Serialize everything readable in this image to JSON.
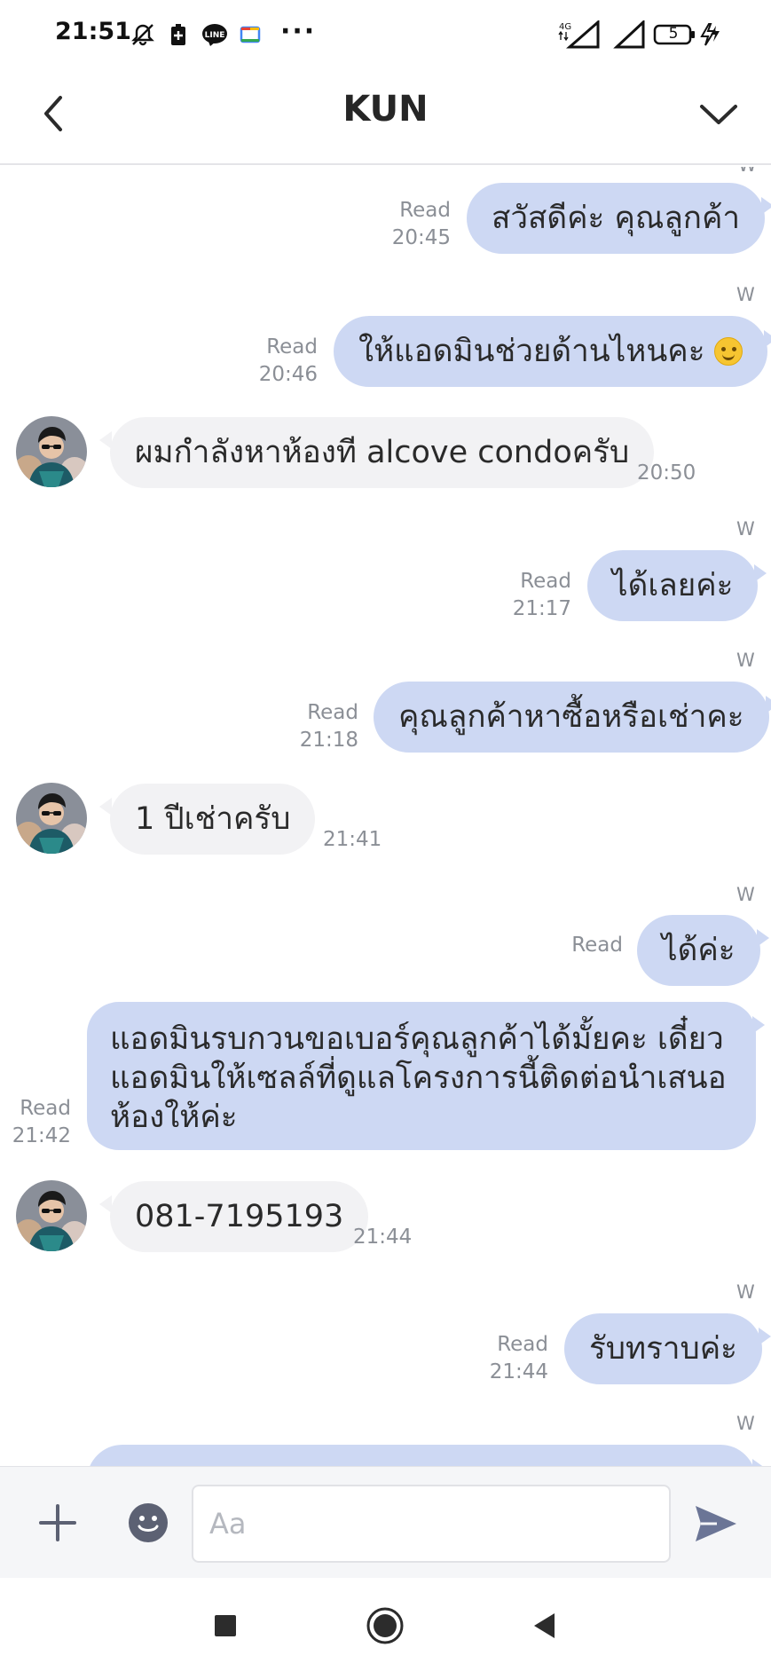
{
  "status_bar": {
    "time": "21:51",
    "network": "4G",
    "battery": "5",
    "icons": [
      "bell-off-icon",
      "battery-saver-icon",
      "line-app-icon",
      "calendar-icon",
      "more-dots-icon"
    ]
  },
  "header": {
    "title": "KUN",
    "back_icon": "chevron-left-icon",
    "more_icon": "chevron-down-icon"
  },
  "messages": [
    {
      "id": 1,
      "dir": "out",
      "sender": "W",
      "text": "สวัสดีค่ะ คุณลูกค้า",
      "read": "Read",
      "time": "20:45"
    },
    {
      "id": 2,
      "dir": "out",
      "sender": "W",
      "text": "ให้แอดมินช่วยด้านไหนคะ",
      "emoji": "smile-emoji",
      "read": "Read",
      "time": "20:46"
    },
    {
      "id": 3,
      "dir": "in",
      "text": "ผมกำลังหาห้องที alcove condoครับ",
      "time": "20:50"
    },
    {
      "id": 4,
      "dir": "out",
      "sender": "W",
      "text": "ได้เลยค่ะ",
      "read": "Read",
      "time": "21:17"
    },
    {
      "id": 5,
      "dir": "out",
      "sender": "W",
      "text": "คุณลูกค้าหาซื้อหรือเช่าคะ",
      "read": "Read",
      "time": "21:18"
    },
    {
      "id": 6,
      "dir": "in",
      "text": "1 ปีเช่าครับ",
      "time": "21:41"
    },
    {
      "id": 7,
      "dir": "out",
      "sender": "W",
      "text": "ได้ค่ะ",
      "read": "Read",
      "time": ""
    },
    {
      "id": 8,
      "dir": "out",
      "text": "แอดมินรบกวนขอเบอร์คุณลูกค้าได้มั้ยคะ เดี๋ยวแอดมินให้เซลล์ที่ดูแลโครงการนี้ติดต่อนำเสนอห้องให้ค่ะ",
      "read": "Read",
      "time": "21:42"
    },
    {
      "id": 9,
      "dir": "in",
      "text": "081-7195193",
      "time": "21:44"
    },
    {
      "id": 10,
      "dir": "out",
      "sender": "W",
      "text": "รับทราบค่ะ",
      "read": "Read",
      "time": "21:44"
    },
    {
      "id": 11,
      "dir": "out",
      "sender": "W",
      "text": "",
      "read": "",
      "time": ""
    }
  ],
  "composer": {
    "placeholder": "Aa",
    "plus_icon": "plus-icon",
    "emoji_icon": "emoji-icon",
    "send_icon": "send-icon"
  },
  "nav": {
    "recents_icon": "square-icon",
    "home_icon": "circle-icon",
    "back_icon": "triangle-back-icon"
  },
  "colors": {
    "outgoing_bubble": "#cdd8f3",
    "incoming_bubble": "#f2f2f4",
    "meta_text": "#8b8f96",
    "icon_gray": "#5c6173",
    "send_icon": "#6b7596"
  }
}
